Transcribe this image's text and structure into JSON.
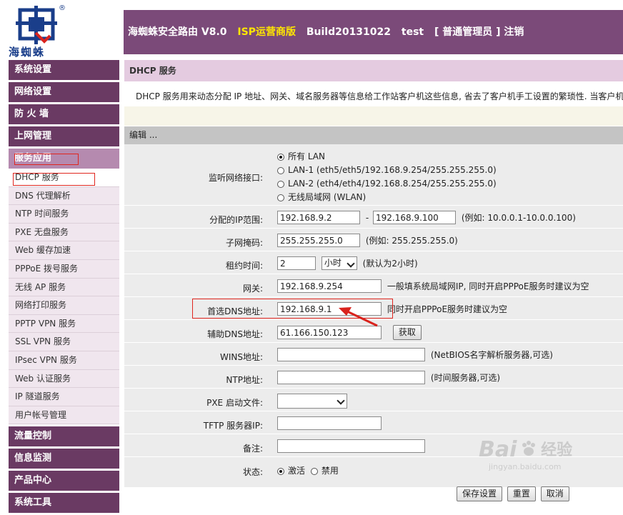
{
  "header": {
    "product": "海蜘蛛安全路由 V8.0",
    "edition": "ISP运营商版",
    "build": "Build20131022",
    "user": "test",
    "role": "[ 普通管理员 ]",
    "logout": "注销"
  },
  "sidebar": {
    "sections_top": [
      "系统设置",
      "网络设置",
      "防 火 墙",
      "上网管理"
    ],
    "current_section": "服务应用",
    "items": [
      "DHCP 服务",
      "DNS 代理解析",
      "NTP 时间服务",
      "PXE 无盘服务",
      "Web 缓存加速",
      "PPPoE 拨号服务",
      "无线 AP 服务",
      "网络打印服务",
      "PPTP VPN 服务",
      "SSL VPN 服务",
      "IPsec VPN 服务",
      "Web 认证服务",
      "IP 隧道服务",
      "用户帐号管理"
    ],
    "sections_bottom": [
      "流量控制",
      "信息监测",
      "产品中心",
      "系统工具"
    ]
  },
  "page": {
    "title": "DHCP 服务",
    "description": "DHCP 服务用来动态分配 IP 地址、网关、域名服务器等信息给工作站客户机这些信息, 省去了客户机手工设置的繁琐性. 当客户机",
    "edit_heading": "编辑 ..."
  },
  "form": {
    "interface": {
      "label": "监听网络接口:",
      "options": [
        "所有 LAN",
        "LAN-1 (eth5/eth5/192.168.9.254/255.255.255.0)",
        "LAN-2 (eth4/eth4/192.168.8.254/255.255.255.0)",
        "无线局域网 (WLAN)"
      ]
    },
    "range": {
      "label": "分配的IP范围:",
      "start": "192.168.9.2",
      "sep": "-",
      "end": "192.168.9.100",
      "hint": "(例如: 10.0.0.1-10.0.0.100)"
    },
    "netmask": {
      "label": "子网掩码:",
      "value": "255.255.255.0",
      "hint": "(例如: 255.255.255.0)"
    },
    "lease": {
      "label": "租约时间:",
      "value": "2",
      "unit": "小时",
      "hint": "(默认为2小时)"
    },
    "gateway": {
      "label": "网关:",
      "value": "192.168.9.254",
      "hint": "一般填系统局域网IP, 同时开启PPPoE服务时建议为空"
    },
    "dns1": {
      "label": "首选DNS地址:",
      "value": "192.168.9.1",
      "hint": "同时开启PPPoE服务时建议为空"
    },
    "dns2": {
      "label": "辅助DNS地址:",
      "value": "61.166.150.123",
      "button": "获取"
    },
    "wins": {
      "label": "WINS地址:",
      "value": "",
      "hint": "(NetBIOS名字解析服务器,可选)"
    },
    "ntp": {
      "label": "NTP地址:",
      "value": "",
      "hint": "(时间服务器,可选)"
    },
    "pxe": {
      "label": "PXE 启动文件:",
      "value": ""
    },
    "tftp": {
      "label": "TFTP 服务器IP:",
      "value": ""
    },
    "note": {
      "label": "备注:",
      "value": ""
    },
    "status": {
      "label": "状态:",
      "enabled": "激活",
      "disabled": "禁用"
    }
  },
  "actions": {
    "save": "保存设置",
    "reset": "重置",
    "cancel": "取消"
  },
  "logo": {
    "text": "海蜘蛛",
    "mark": "®"
  },
  "watermark": {
    "text": "Bai",
    "text2": "经验",
    "url": "jingyan.baidu.com"
  }
}
